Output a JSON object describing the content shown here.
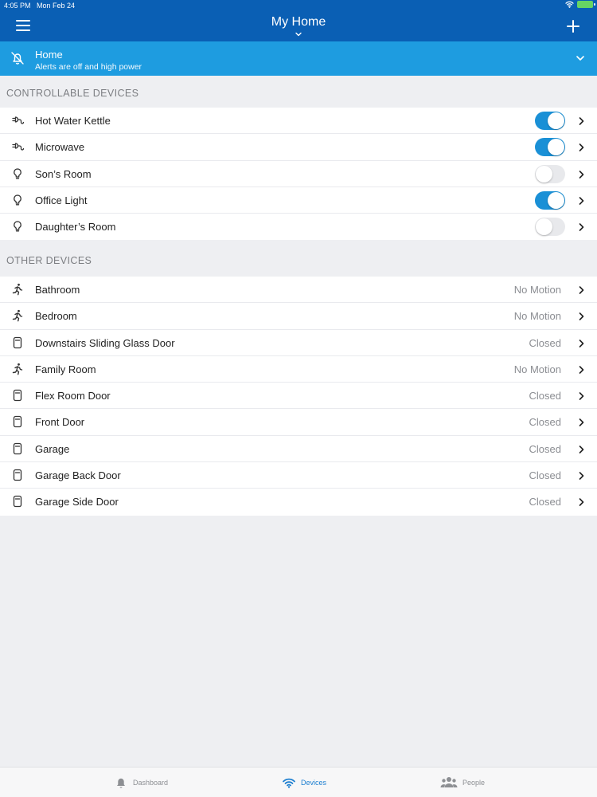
{
  "status_bar": {
    "time": "4:05 PM",
    "date": "Mon Feb 24"
  },
  "header": {
    "title": "My Home"
  },
  "mode": {
    "name": "Home",
    "description": "Alerts are off and high power"
  },
  "controllable": {
    "header": "CONTROLLABLE DEVICES",
    "items": [
      {
        "label": "Hot Water Kettle",
        "icon": "plug-icon",
        "on": true
      },
      {
        "label": "Microwave",
        "icon": "plug-icon",
        "on": true
      },
      {
        "label": "Son’s Room",
        "icon": "light-bulb-icon",
        "on": false
      },
      {
        "label": "Office Light",
        "icon": "light-bulb-icon",
        "on": true
      },
      {
        "label": "Daughter’s Room",
        "icon": "light-bulb-icon",
        "on": false
      }
    ]
  },
  "other": {
    "header": "OTHER DEVICES",
    "items": [
      {
        "label": "Bathroom",
        "icon": "motion-sensor-icon",
        "status": "No Motion"
      },
      {
        "label": "Bedroom",
        "icon": "motion-sensor-icon",
        "status": "No Motion"
      },
      {
        "label": "Downstairs Sliding Glass Door",
        "icon": "door-sensor-icon",
        "status": "Closed"
      },
      {
        "label": "Family Room",
        "icon": "motion-sensor-icon",
        "status": "No Motion"
      },
      {
        "label": "Flex Room Door",
        "icon": "door-sensor-icon",
        "status": "Closed"
      },
      {
        "label": "Front Door",
        "icon": "door-sensor-icon",
        "status": "Closed"
      },
      {
        "label": "Garage",
        "icon": "door-sensor-icon",
        "status": "Closed"
      },
      {
        "label": "Garage Back Door",
        "icon": "door-sensor-icon",
        "status": "Closed"
      },
      {
        "label": "Garage Side Door",
        "icon": "door-sensor-icon",
        "status": "Closed"
      }
    ]
  },
  "tabbar": {
    "tabs": [
      {
        "label": "Dashboard",
        "icon": "bell-icon",
        "active": false
      },
      {
        "label": "Devices",
        "icon": "wifi-icon",
        "active": true
      },
      {
        "label": "People",
        "icon": "people-icon",
        "active": false
      }
    ]
  },
  "colors": {
    "header": "#0a5fb4",
    "mode_banner": "#1e9ce0",
    "toggle_on": "#1a90d6",
    "active_tab": "#1d7fd0"
  }
}
